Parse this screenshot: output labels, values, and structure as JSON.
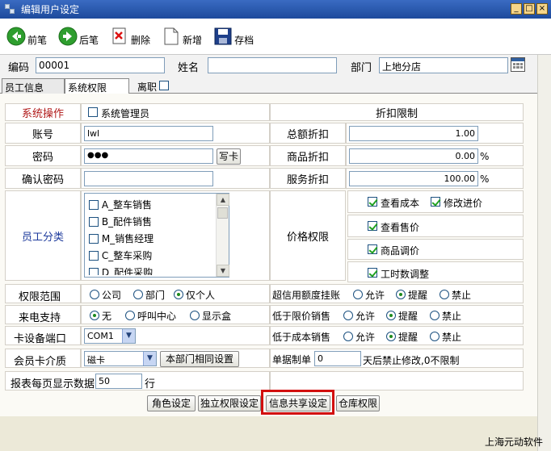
{
  "window": {
    "title": "编辑用户设定",
    "buttons": [
      "_",
      "□",
      "×"
    ]
  },
  "toolbar": {
    "prev": "前笔",
    "next": "后笔",
    "delete": "删除",
    "add": "新增",
    "save": "存档"
  },
  "header": {
    "code_label": "编码",
    "code_value": "00001",
    "name_label": "姓名",
    "name_value": "",
    "dept_label": "部门",
    "dept_value": "上地分店"
  },
  "tabs": {
    "employee_info": "员工信息",
    "system_rights": "系统权限",
    "resigned_label": "离职"
  },
  "left": {
    "system_op_label": "系统操作",
    "sys_admin_label": "系统管理员",
    "account_label": "账号",
    "account_value": "lwl",
    "password_label": "密码",
    "password_value": "●●●",
    "write_card": "写卡",
    "confirm_pwd_label": "确认密码",
    "confirm_pwd_value": "",
    "emp_category_label": "员工分类",
    "categories": [
      {
        "label": "A_整车销售",
        "checked": false
      },
      {
        "label": "B_配件销售",
        "checked": false
      },
      {
        "label": "M_销售经理",
        "checked": false
      },
      {
        "label": "C_整车采购",
        "checked": false
      },
      {
        "label": "D_配件采购",
        "checked": false
      }
    ],
    "scope_label": "权限范围",
    "scope_options": [
      "公司",
      "部门",
      "仅个人"
    ],
    "scope_selected": "仅个人",
    "callin_label": "来电支持",
    "callin_options": [
      "无",
      "呼叫中心",
      "显示盒"
    ],
    "callin_selected": "无",
    "card_port_label": "卡设备端口",
    "card_port_value": "COM1",
    "member_card_label": "会员卡介质",
    "member_card_value": "磁卡",
    "same_dept_btn": "本部门相同设置",
    "report_rows_label": "报表每页显示数据",
    "report_rows_value": "50",
    "report_rows_unit": "行"
  },
  "right": {
    "discount_header": "折扣限制",
    "total_discount_label": "总额折扣",
    "total_discount_value": "1.00",
    "product_discount_label": "商品折扣",
    "product_discount_value": "0.00",
    "service_discount_label": "服务折扣",
    "service_discount_value": "100.00",
    "percent": "%",
    "price_rights_label": "价格权限",
    "price_rights": {
      "view_cost": "查看成本",
      "edit_purchase": "修改进价",
      "view_sale_price": "查看售价",
      "adjust_price": "商品调价",
      "labor_adjust": "工时数调整"
    },
    "credit_over_label": "超信用额度挂账",
    "below_limit_label": "低于限价销售",
    "below_cost_label": "低于成本销售",
    "tri_options": [
      "允许",
      "提醒",
      "禁止"
    ],
    "credit_over_selected": "提醒",
    "below_limit_selected": "提醒",
    "below_cost_selected": "提醒",
    "doc_label": "单据制单",
    "doc_value": "0",
    "doc_suffix": "天后禁止修改,0不限制"
  },
  "bottom_buttons": {
    "role": "角色设定",
    "independent": "独立权限设定",
    "info_share": "信息共享设定",
    "warehouse": "仓库权限"
  },
  "footer": "上海元动软件"
}
